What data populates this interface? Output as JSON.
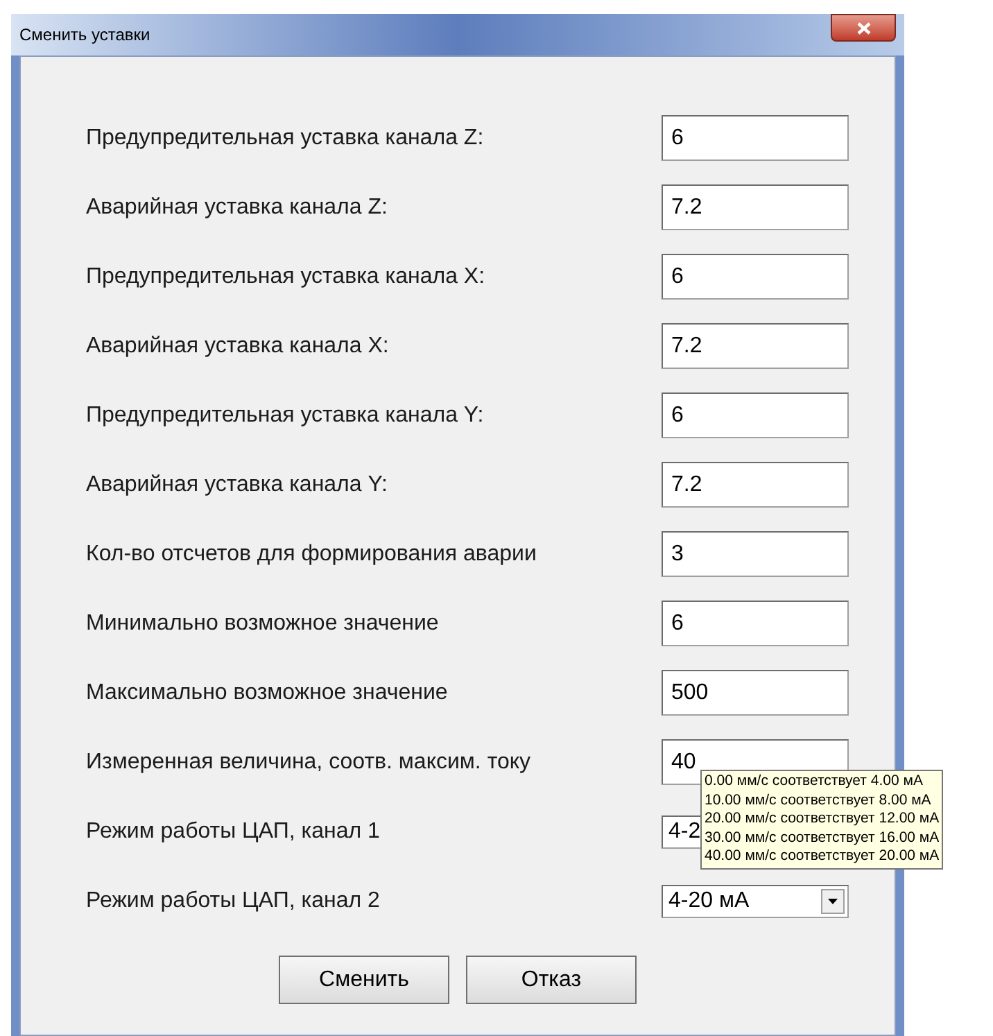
{
  "window": {
    "title": "Сменить уставки"
  },
  "fields": [
    {
      "kind": "input",
      "label": "Предупредительная уставка канала Z:",
      "value": "6"
    },
    {
      "kind": "input",
      "label": "Аварийная уставка канала Z:",
      "value": "7.2"
    },
    {
      "kind": "input",
      "label": "Предупредительная уставка канала X:",
      "value": "6"
    },
    {
      "kind": "input",
      "label": "Аварийная уставка канала X:",
      "value": "7.2"
    },
    {
      "kind": "input",
      "label": "Предупредительная уставка канала Y:",
      "value": "6"
    },
    {
      "kind": "input",
      "label": "Аварийная уставка канала Y:",
      "value": "7.2"
    },
    {
      "kind": "input",
      "label": "Кол-во отсчетов для формирования аварии",
      "value": "3"
    },
    {
      "kind": "input",
      "label": "Минимально возможное значение",
      "value": "6"
    },
    {
      "kind": "input",
      "label": "Максимально возможное значение",
      "value": "500"
    },
    {
      "kind": "input",
      "label": "Измеренная величина, соотв. максим. току",
      "value": "40"
    },
    {
      "kind": "covered-select",
      "label": "Режим работы ЦАП, канал 1",
      "value": "4-2"
    },
    {
      "kind": "select",
      "label": "Режим работы ЦАП, канал 2",
      "value": "4-20 мА"
    }
  ],
  "tooltip": {
    "lines": [
      "0.00 мм/с соответствует 4.00 мА",
      "10.00 мм/с соответствует 8.00 мА",
      "20.00 мм/с соответствует 12.00 мА",
      "30.00 мм/с соответствует 16.00 мА",
      "40.00 мм/с соответствует 20.00 мА"
    ]
  },
  "buttons": [
    "Сменить",
    "Отказ"
  ]
}
